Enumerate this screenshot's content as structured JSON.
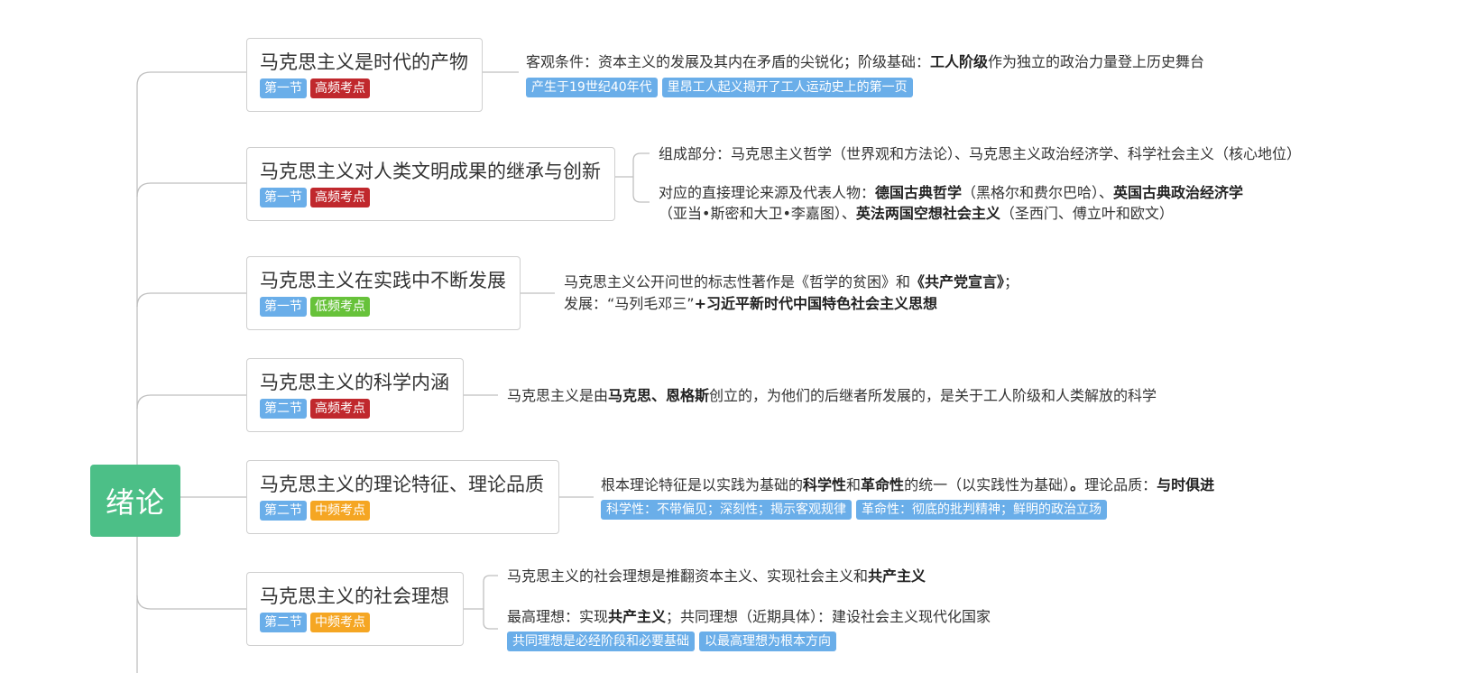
{
  "root": {
    "label": "绪论"
  },
  "topics": [
    {
      "title": "马克思主义是时代的产物",
      "tags": [
        {
          "label": "第一节",
          "kind": "section"
        },
        {
          "label": "高频考点",
          "kind": "high"
        }
      ],
      "lines": [
        [
          {
            "text": "客观条件：资本主义的发展及其内在矛盾的尖锐化；阶级基础：",
            "bold": false
          },
          {
            "text": "工人阶级",
            "bold": true
          },
          {
            "text": "作为独立的政治力量登上历史舞台",
            "bold": false
          }
        ]
      ],
      "chips": [
        "产生于19世纪40年代",
        "里昂工人起义揭开了工人运动史上的第一页"
      ]
    },
    {
      "title": "马克思主义对人类文明成果的继承与创新",
      "tags": [
        {
          "label": "第一节",
          "kind": "section"
        },
        {
          "label": "高频考点",
          "kind": "high"
        }
      ],
      "lines": [
        [
          {
            "text": "组成部分：马克思主义哲学（世界观和方法论）、马克思主义政治经济学、科学社会主义（核心地位）",
            "bold": false
          }
        ],
        [
          {
            "text": "对应的直接理论来源及代表人物：",
            "bold": false
          },
          {
            "text": "德国古典哲学",
            "bold": true
          },
          {
            "text": "（黑格尔和费尔巴哈）、",
            "bold": false
          },
          {
            "text": "英国古典政治经济学",
            "bold": true
          }
        ],
        [
          {
            "text": "（亚当•斯密和大卫•李嘉图）、",
            "bold": false
          },
          {
            "text": "英法两国空想社会主义",
            "bold": true
          },
          {
            "text": "（圣西门、傅立叶和欧文）",
            "bold": false
          }
        ]
      ],
      "chips": []
    },
    {
      "title": "马克思主义在实践中不断发展",
      "tags": [
        {
          "label": "第一节",
          "kind": "section"
        },
        {
          "label": "低频考点",
          "kind": "low"
        }
      ],
      "lines": [
        [
          {
            "text": "马克思主义公开问世的标志性著作是《哲学的贫困》和",
            "bold": false
          },
          {
            "text": "《共产党宣言》",
            "bold": true
          },
          {
            "text": "；",
            "bold": false
          }
        ],
        [
          {
            "text": "发展：“马列毛邓三”",
            "bold": false
          },
          {
            "text": "+习近平新时代中国特色社会主义思想",
            "bold": true
          }
        ]
      ],
      "chips": []
    },
    {
      "title": "马克思主义的科学内涵",
      "tags": [
        {
          "label": "第二节",
          "kind": "section"
        },
        {
          "label": "高频考点",
          "kind": "high"
        }
      ],
      "lines": [
        [
          {
            "text": "马克思主义是由",
            "bold": false
          },
          {
            "text": "马克思、恩格斯",
            "bold": true
          },
          {
            "text": "创立的，为他们的后继者所发展的，是关于工人阶级和人类解放的科学",
            "bold": false
          }
        ]
      ],
      "chips": []
    },
    {
      "title": "马克思主义的理论特征、理论品质",
      "tags": [
        {
          "label": "第二节",
          "kind": "section"
        },
        {
          "label": "中频考点",
          "kind": "mid"
        }
      ],
      "lines": [
        [
          {
            "text": "根本理论特征是以实践为基础的",
            "bold": false
          },
          {
            "text": "科学性",
            "bold": true
          },
          {
            "text": "和",
            "bold": false
          },
          {
            "text": "革命性",
            "bold": true
          },
          {
            "text": "的统一（以实践性为基础）",
            "bold": false
          },
          {
            "text": "。",
            "bold": true
          },
          {
            "text": "理论品质：",
            "bold": false
          },
          {
            "text": "与时俱进",
            "bold": true
          }
        ]
      ],
      "chips": [
        "科学性：不带偏见；深刻性；揭示客观规律",
        "革命性：彻底的批判精神；鲜明的政治立场"
      ]
    },
    {
      "title": "马克思主义的社会理想",
      "tags": [
        {
          "label": "第二节",
          "kind": "section"
        },
        {
          "label": "中频考点",
          "kind": "mid"
        }
      ],
      "lines": [
        [
          {
            "text": "马克思主义的社会理想是推翻资本主义、实现社会主义和",
            "bold": false
          },
          {
            "text": "共产主义",
            "bold": true
          }
        ],
        [
          {
            "text": "最高理想：实现",
            "bold": false
          },
          {
            "text": "共产主义",
            "bold": true
          },
          {
            "text": "；共同理想（近期具体）：建设社会主义现代化国家",
            "bold": false
          }
        ]
      ],
      "chips": [
        "共同理想是必经阶段和必要基础",
        "以最高理想为根本方向"
      ]
    }
  ]
}
